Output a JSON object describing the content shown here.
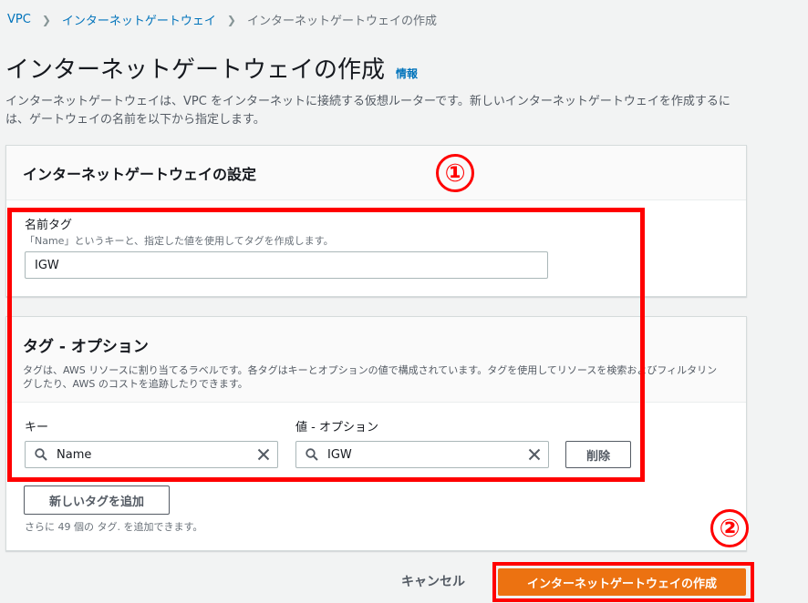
{
  "breadcrumb": {
    "items": [
      "VPC",
      "インターネットゲートウェイ",
      "インターネットゲートウェイの作成"
    ]
  },
  "page": {
    "title": "インターネットゲートウェイの作成",
    "info_link": "情報",
    "description": "インターネットゲートウェイは、VPC をインターネットに接続する仮想ルーターです。新しいインターネットゲートウェイを作成するには、ゲートウェイの名前を以下から指定します。"
  },
  "settings_panel": {
    "title": "インターネットゲートウェイの設定",
    "name_tag_label": "名前タグ",
    "name_tag_description": "「Name」というキーと、指定した値を使用してタグを作成します。",
    "name_tag_value": "IGW"
  },
  "tags_panel": {
    "title": "タグ - オプション",
    "description": "タグは、AWS リソースに割り当てるラベルです。各タグはキーとオプションの値で構成されています。タグを使用してリソースを検索およびフィルタリングしたり、AWS のコストを追跡したりできます。",
    "key_label": "キー",
    "value_label": "値 - オプション",
    "key_value": "Name",
    "value_value": "IGW",
    "remove_button": "削除",
    "add_tag_button": "新しいタグを追加",
    "hint": "さらに 49 個の タグ. を追加できます。"
  },
  "footer": {
    "cancel_label": "キャンセル",
    "create_label": "インターネットゲートウェイの作成"
  },
  "annotations": {
    "step1": "①",
    "step2": "②"
  },
  "colors": {
    "primary": "#ec7211",
    "link": "#0073bb",
    "highlight": "#ff0000"
  }
}
